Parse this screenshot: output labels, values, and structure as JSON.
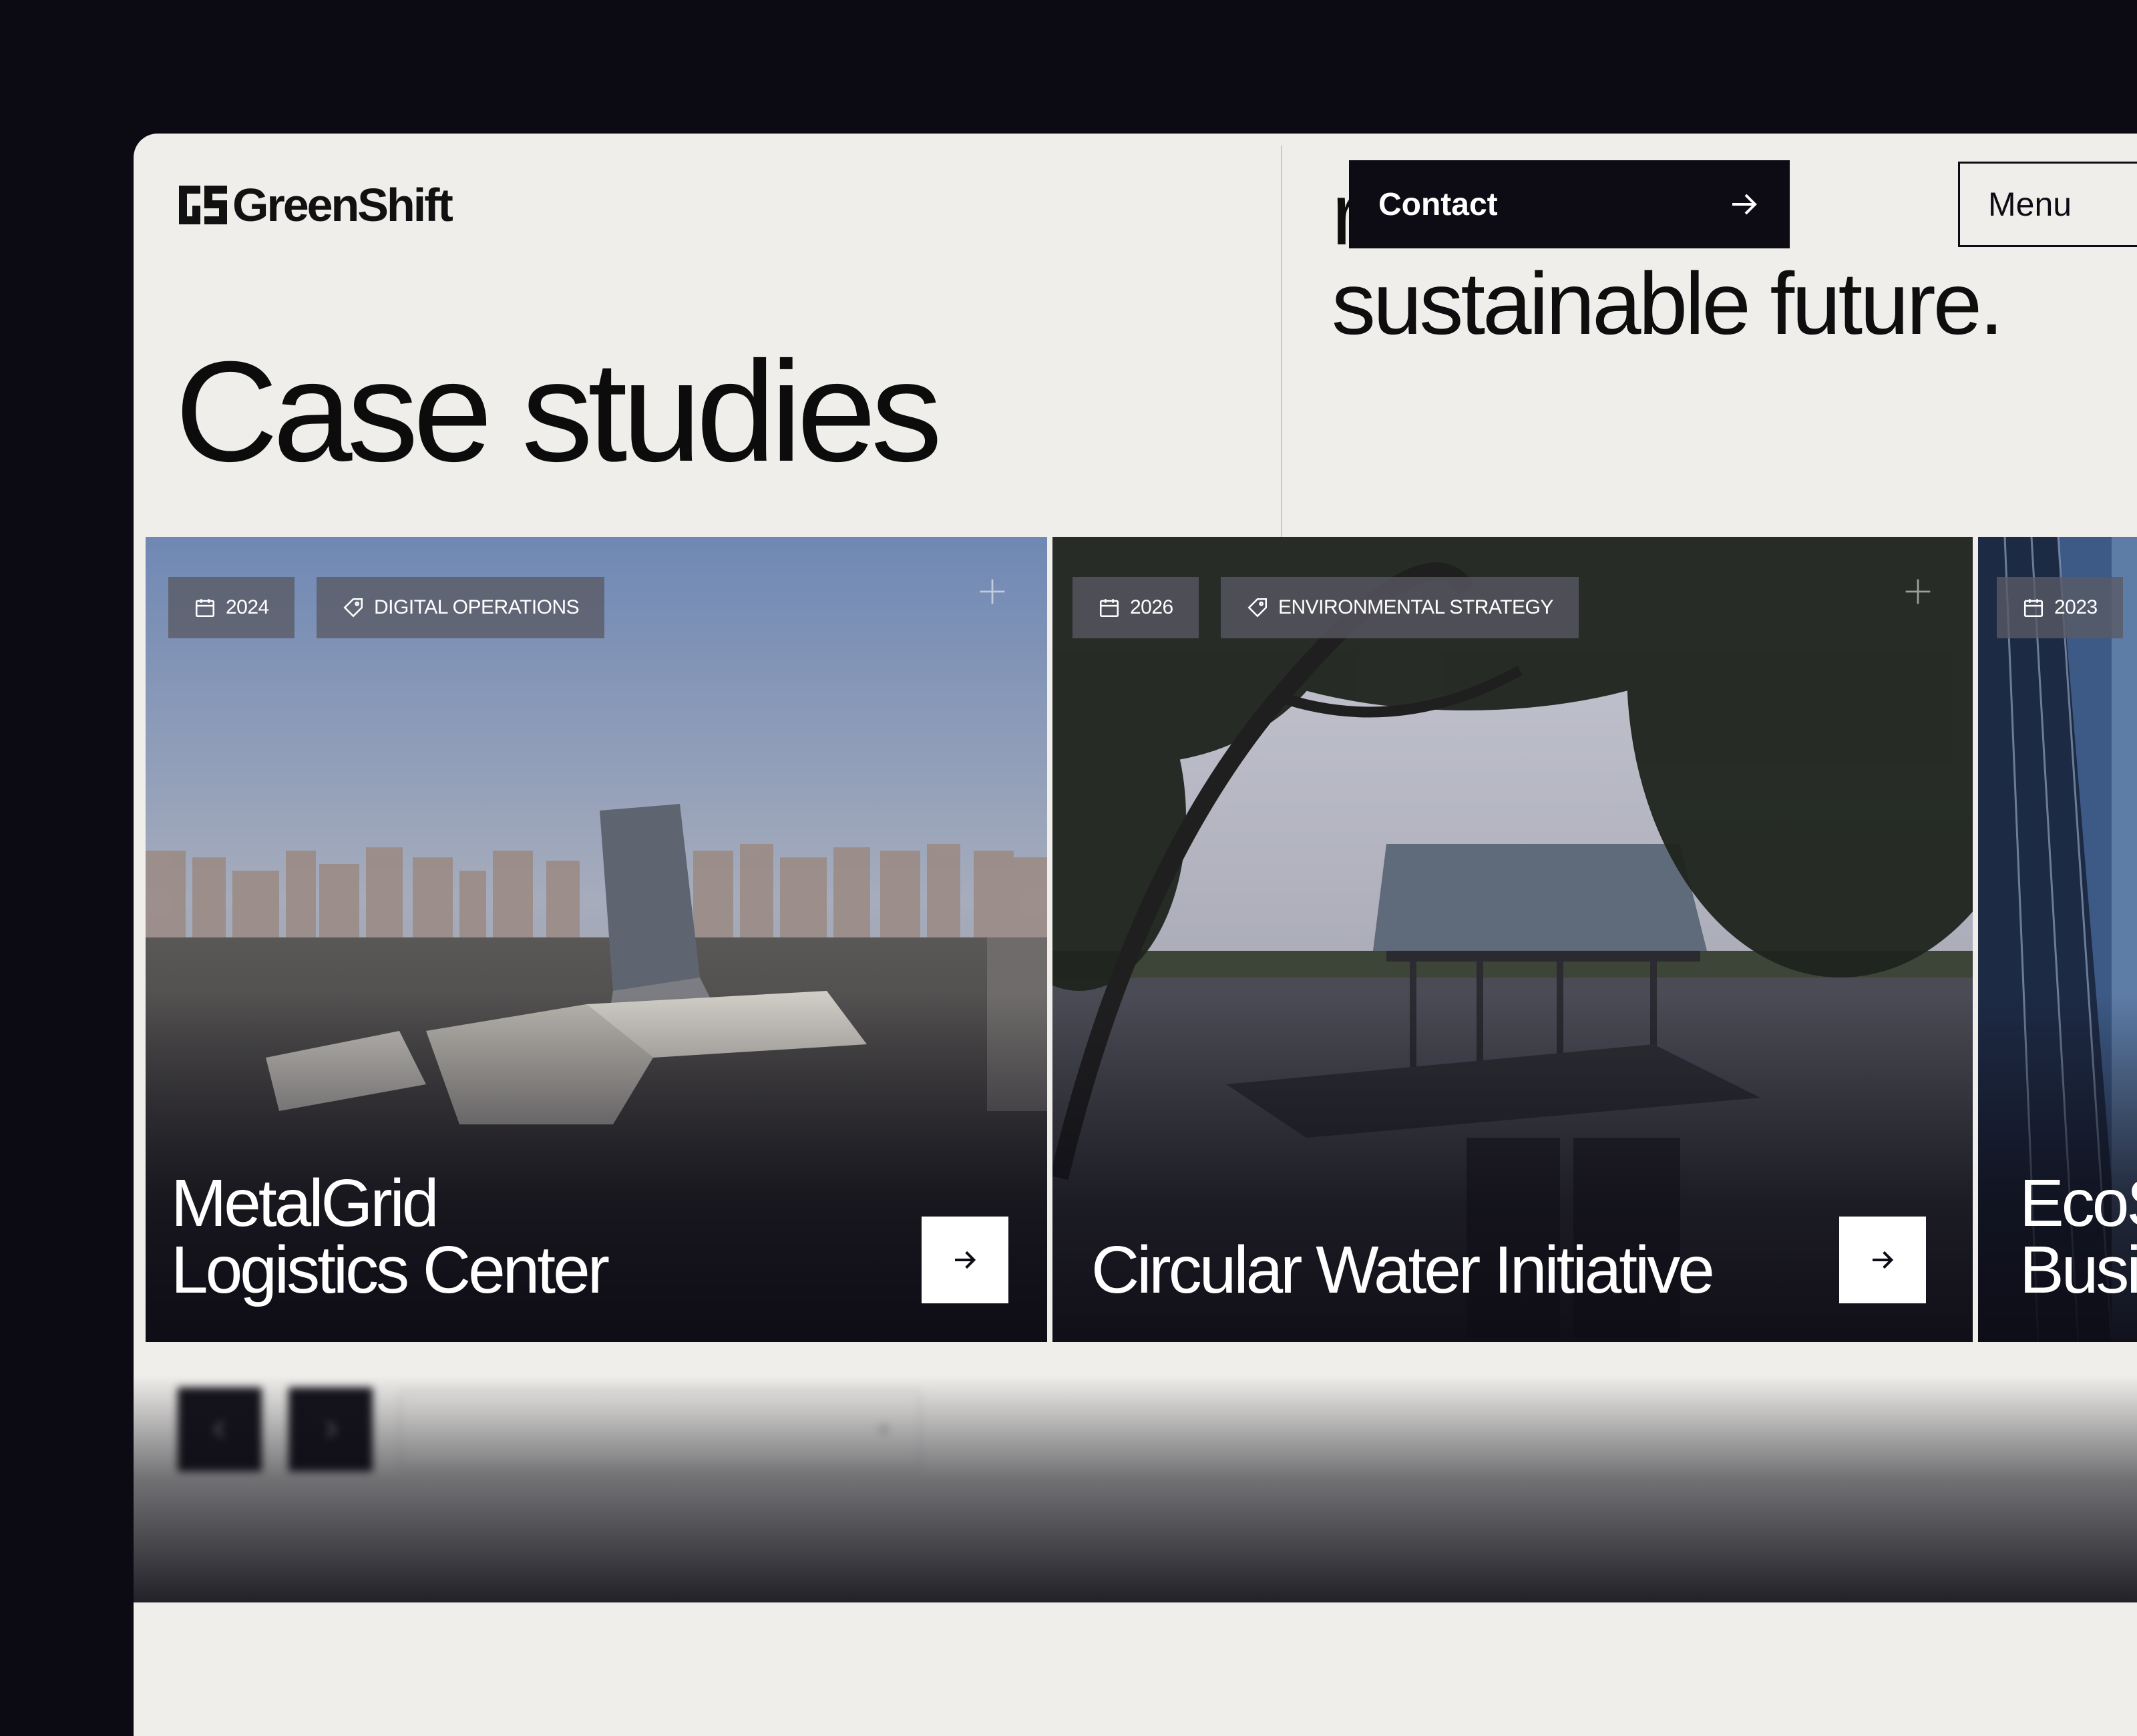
{
  "brand": {
    "name": "GreenShift",
    "logo_icon": "gs-monogram-icon"
  },
  "header": {
    "tagline_lines": [
      "resil",
      "sustainable future."
    ],
    "contact_label": "Contact",
    "menu_label": "Menu"
  },
  "page": {
    "title": "Case studies"
  },
  "cards": [
    {
      "year": "2024",
      "category": "DIGITAL OPERATIONS",
      "title_lines": [
        "MetalGrid",
        "Logistics Center"
      ]
    },
    {
      "year": "2026",
      "category": "ENVIRONMENTAL STRATEGY",
      "title_lines": [
        "Circular Water Initiative"
      ]
    },
    {
      "year": "2023",
      "title_lines": [
        "EcoS",
        "Busi"
      ]
    }
  ],
  "icons": {
    "calendar": "calendar-icon",
    "tag": "tag-icon",
    "plus": "plus-icon",
    "arrow": "arrow-right-icon"
  },
  "colors": {
    "ink": "#0d0c15",
    "paper": "#efeeeb",
    "chip": "#5a5a64"
  }
}
